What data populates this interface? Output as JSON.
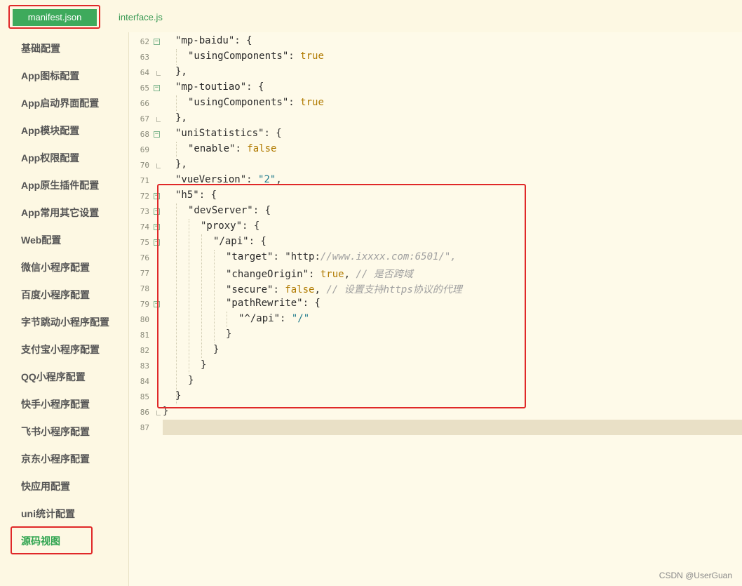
{
  "tabs": [
    {
      "label": "manifest.json",
      "active": true
    },
    {
      "label": "interface.js",
      "active": false
    }
  ],
  "sidebar": {
    "items": [
      {
        "label": "基础配置"
      },
      {
        "label": "App图标配置"
      },
      {
        "label": "App启动界面配置"
      },
      {
        "label": "App模块配置"
      },
      {
        "label": "App权限配置"
      },
      {
        "label": "App原生插件配置"
      },
      {
        "label": "App常用其它设置"
      },
      {
        "label": "Web配置"
      },
      {
        "label": "微信小程序配置"
      },
      {
        "label": "百度小程序配置"
      },
      {
        "label": "字节跳动小程序配置"
      },
      {
        "label": "支付宝小程序配置"
      },
      {
        "label": "QQ小程序配置"
      },
      {
        "label": "快手小程序配置"
      },
      {
        "label": "飞书小程序配置"
      },
      {
        "label": "京东小程序配置"
      },
      {
        "label": "快应用配置"
      },
      {
        "label": "uni统计配置"
      },
      {
        "label": "源码视图",
        "active": true
      }
    ]
  },
  "editor": {
    "lines": [
      {
        "n": "62",
        "text": "\"mp-baidu\": {"
      },
      {
        "n": "63",
        "text": "\"usingComponents\": true"
      },
      {
        "n": "64",
        "text": "},"
      },
      {
        "n": "65",
        "text": "\"mp-toutiao\": {"
      },
      {
        "n": "66",
        "text": "\"usingComponents\": true"
      },
      {
        "n": "67",
        "text": "},"
      },
      {
        "n": "68",
        "text": "\"uniStatistics\": {"
      },
      {
        "n": "69",
        "text": "\"enable\": false"
      },
      {
        "n": "70",
        "text": "},"
      },
      {
        "n": "71",
        "text": "\"vueVersion\": \"2\","
      },
      {
        "n": "72",
        "text": "\"h5\": {"
      },
      {
        "n": "73",
        "text": "\"devServer\": {"
      },
      {
        "n": "74",
        "text": "\"proxy\": {"
      },
      {
        "n": "75",
        "text": "\"/api\": {"
      },
      {
        "n": "76",
        "text": "\"target\": \"http://www.ixxxx.com:6501/\","
      },
      {
        "n": "77",
        "text": "\"changeOrigin\": true, // 是否跨域"
      },
      {
        "n": "78",
        "text": "\"secure\": false, // 设置支持https协议的代理"
      },
      {
        "n": "79",
        "text": "\"pathRewrite\": {"
      },
      {
        "n": "80",
        "text": "\"^/api\": \"/\""
      },
      {
        "n": "81",
        "text": "}"
      },
      {
        "n": "82",
        "text": "}"
      },
      {
        "n": "83",
        "text": "}"
      },
      {
        "n": "84",
        "text": "}"
      },
      {
        "n": "85",
        "text": "}"
      },
      {
        "n": "86",
        "text": "}"
      },
      {
        "n": "87",
        "text": ""
      }
    ]
  },
  "watermark": "CSDN @UserGuan",
  "colors": {
    "accent": "#3eaa5c",
    "highlight_box": "#e02828",
    "background": "#fefae9"
  }
}
